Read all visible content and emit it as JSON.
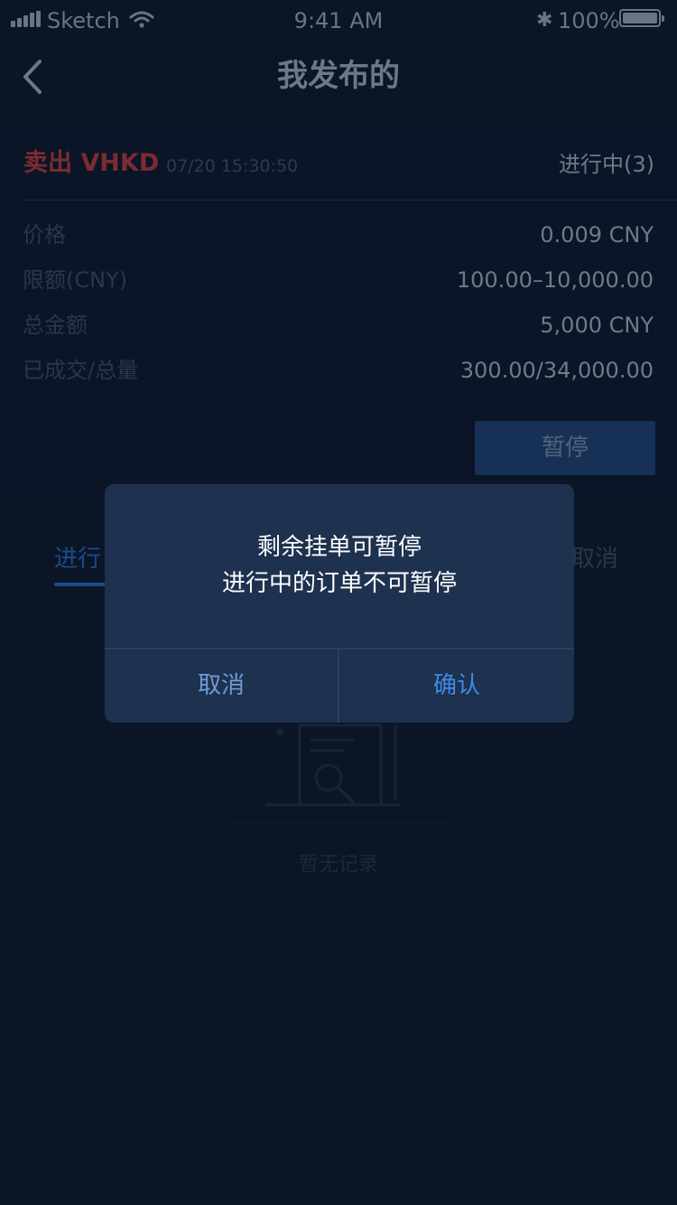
{
  "status_bar": {
    "carrier": "Sketch",
    "time": "9:41 AM",
    "bluetooth": "✱",
    "battery": "100%"
  },
  "nav": {
    "title": "我发布的",
    "back_icon": "chevron-left-icon"
  },
  "order": {
    "type": "卖出 VHKD",
    "time": "07/20 15:30:50",
    "status": "进行中(3)",
    "rows": [
      {
        "label": "价格",
        "value": "0.009 CNY"
      },
      {
        "label": "限额(CNY)",
        "value": "100.00–10,000.00"
      },
      {
        "label": "总金额",
        "value": "5,000 CNY"
      },
      {
        "label": "已成交/总量",
        "value": "300.00/34,000.00"
      }
    ],
    "pause_button": "暂停"
  },
  "tabs": {
    "left": "进行",
    "right": "取消"
  },
  "empty_state": {
    "icon": "document-search-icon",
    "text": "暂无记录"
  },
  "dialog": {
    "line1": "剩余挂单可暂停",
    "line2": "进行中的订单不可暂停",
    "cancel": "取消",
    "confirm": "确认"
  },
  "colors": {
    "background": "#0b1526",
    "dialog": "#1e314f",
    "confirm": "#3d8ce6",
    "sell": "#7a2c31"
  }
}
